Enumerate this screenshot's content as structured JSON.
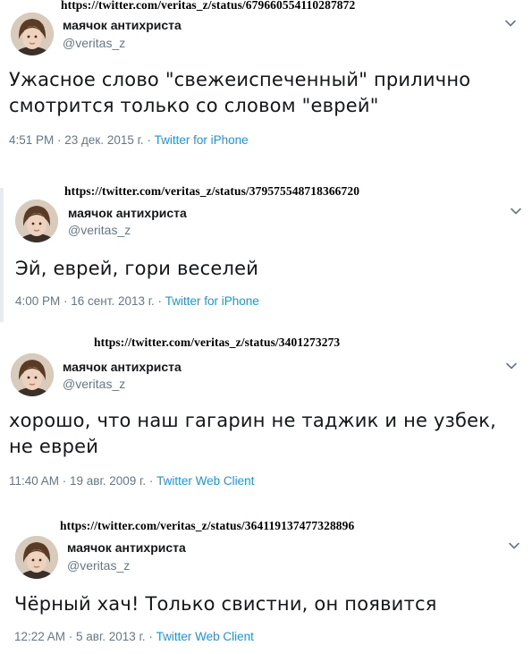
{
  "tweets": [
    {
      "url": "https://twitter.com/veritas_z/status/679660554110287872",
      "name": "маячок антихриста",
      "handle": "@veritas_z",
      "text": "Ужасное слово \"свежеиспеченный\" прилично смотрится только со словом \"еврей\"",
      "time": "4:51 PM · 23 дек. 2015 г. · ",
      "source": "Twitter for iPhone",
      "avatar_icon": "profile-photo",
      "menu_icon": "chevron-down-icon"
    },
    {
      "url": "https://twitter.com/veritas_z/status/379575548718366720",
      "name": "маячок антихриста",
      "handle": "@veritas_z",
      "text": "Эй, еврей, гори веселей",
      "time": "4:00 PM · 16 сент. 2013 г. · ",
      "source": "Twitter for iPhone",
      "avatar_icon": "profile-photo",
      "menu_icon": "chevron-down-icon"
    },
    {
      "url": "https://twitter.com/veritas_z/status/3401273273",
      "name": "маячок антихриста",
      "handle": "@veritas_z",
      "text": "хорошо, что наш гагарин не таджик и не узбек, не еврей",
      "time": "11:40 AM · 19 авг. 2009 г. · ",
      "source": "Twitter Web Client",
      "avatar_icon": "profile-photo",
      "menu_icon": "chevron-down-icon"
    },
    {
      "url": "https://twitter.com/veritas_z/status/364119137477328896",
      "name": "маячок антихриста",
      "handle": "@veritas_z",
      "text": "Чёрный хач! Только свистни, он появится",
      "time": "12:22 AM · 5 авг. 2013 г. · ",
      "source": "Twitter Web Client",
      "avatar_icon": "profile-photo",
      "menu_icon": "chevron-down-icon"
    }
  ],
  "colors": {
    "text": "#14171a",
    "secondary": "#657786",
    "link": "#1b95e0"
  }
}
